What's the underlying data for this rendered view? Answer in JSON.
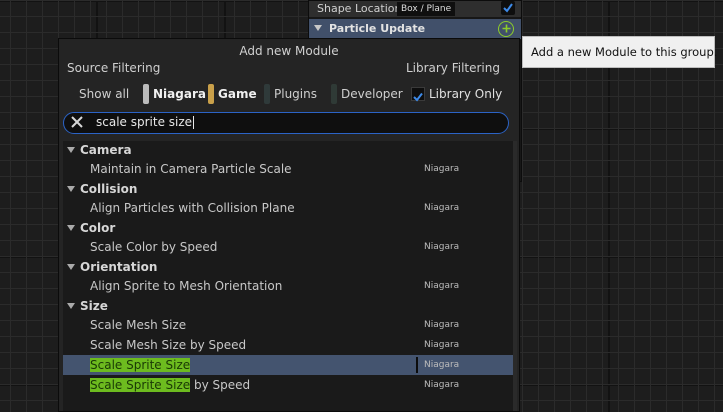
{
  "node": {
    "shape_location_label": "Shape Location",
    "shape_location_value": "Box / Plane",
    "section_title": "Particle Update",
    "add_icon": "plus-circle-icon"
  },
  "tooltip": "Add a new Module to this group.",
  "popup": {
    "title": "Add new Module",
    "source_filtering_label": "Source Filtering",
    "library_filtering_label": "Library Filtering",
    "show_all": "Show all",
    "filters": [
      {
        "label": "Niagara",
        "color": "#bbbbbb",
        "active": true
      },
      {
        "label": "Game",
        "color": "#c9a04a",
        "active": true
      },
      {
        "label": "Plugins",
        "color": "#2f3a3a",
        "active": false
      },
      {
        "label": "Developer",
        "color": "#2f3a36",
        "active": false
      }
    ],
    "library_only_label": "Library Only",
    "library_only_checked": true,
    "search_value": "scale sprite size",
    "clear_icon": "close-icon"
  },
  "results": [
    {
      "category": "Camera",
      "items": [
        {
          "name": "Maintain in Camera Particle Scale",
          "library": "Niagara"
        }
      ]
    },
    {
      "category": "Collision",
      "items": [
        {
          "name": "Align Particles with Collision Plane",
          "library": "Niagara"
        }
      ]
    },
    {
      "category": "Color",
      "items": [
        {
          "name": "Scale Color by Speed",
          "library": "Niagara"
        }
      ]
    },
    {
      "category": "Orientation",
      "items": [
        {
          "name": "Align Sprite to Mesh Orientation",
          "library": "Niagara"
        }
      ]
    },
    {
      "category": "Size",
      "items": [
        {
          "name": "Scale Mesh Size",
          "library": "Niagara"
        },
        {
          "name": "Scale Mesh Size by Speed",
          "library": "Niagara"
        },
        {
          "name": "Scale Sprite Size",
          "library": "Niagara",
          "selected": true,
          "match": "Scale Sprite Size",
          "rest": ""
        },
        {
          "name": "Scale Sprite Size by Speed",
          "library": "Niagara",
          "match": "Scale Sprite Size",
          "rest": " by Speed"
        }
      ]
    }
  ],
  "colors": {
    "accent_blue": "#2b63c6",
    "selection": "#44546f",
    "match_highlight": "#6dbb1f",
    "add_button": "#8ccd2a"
  }
}
